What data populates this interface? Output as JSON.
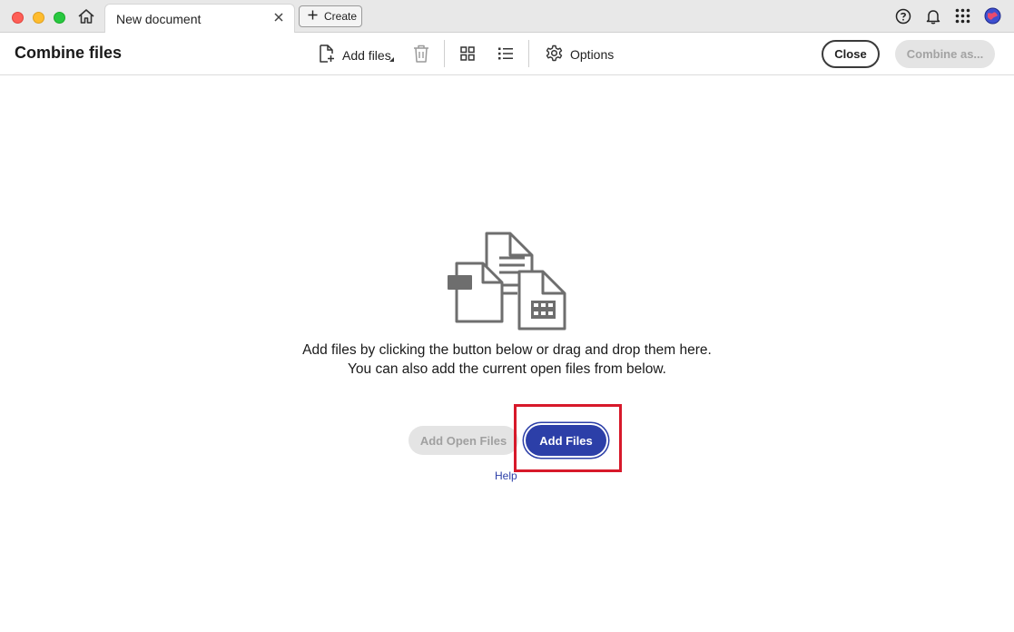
{
  "titlebar": {
    "tab_title": "New document",
    "create_label": "Create",
    "icons": [
      "help-icon",
      "bell-icon",
      "apps-icon",
      "globe-avatar-icon"
    ]
  },
  "toolbar": {
    "page_title": "Combine files",
    "add_files_label": "Add files",
    "options_label": "Options",
    "close_label": "Close",
    "combine_label": "Combine as..."
  },
  "main": {
    "message_line1": "Add files by clicking the button below or drag and drop them here.",
    "message_line2": "You can also add the current open files from below.",
    "add_open_files_label": "Add Open Files",
    "add_files_label": "Add Files",
    "help_label": "Help"
  },
  "colors": {
    "accent": "#2c3fa8",
    "highlight": "#d7192a",
    "disabled_bg": "#e4e4e4"
  }
}
